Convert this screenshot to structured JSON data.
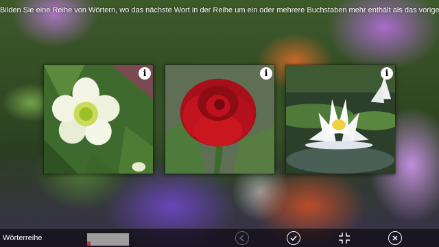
{
  "instruction": "Bilden Sie eine Reihe von Wörtern, wo das nächste Wort in der Reihe um ein oder mehrere Buchstaben mehr enthält als das vorige!",
  "cards": [
    {
      "subject": "white hellebore flower",
      "info_label": "i"
    },
    {
      "subject": "red rose",
      "info_label": "i"
    },
    {
      "subject": "white water lily",
      "info_label": "i"
    }
  ],
  "bottom_bar": {
    "title": "Wörterreihe",
    "progress_fraction": 0.08,
    "buttons": [
      "previous",
      "confirm",
      "collapse",
      "close"
    ]
  },
  "colors": {
    "bar_background": "#000000",
    "progress_track": "#9e9e9e",
    "progress_fill": "#c0392b"
  }
}
